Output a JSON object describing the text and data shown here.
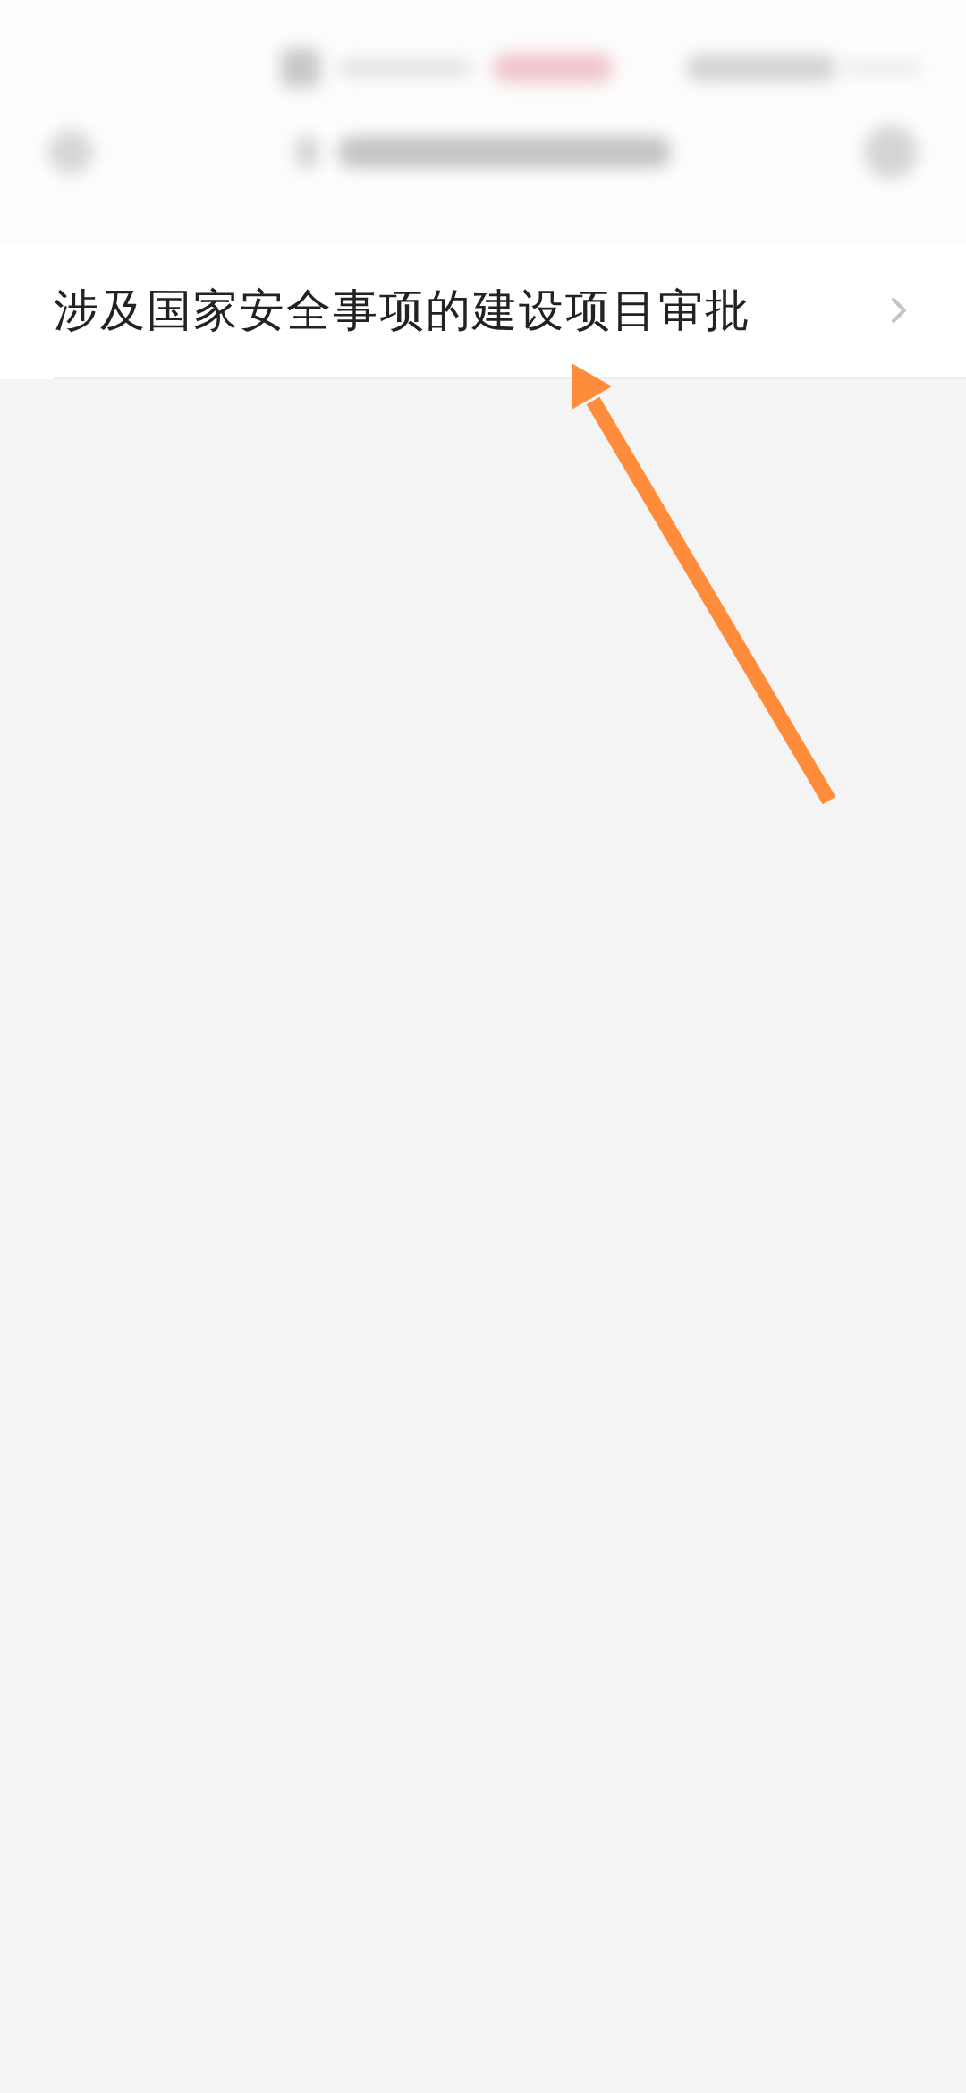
{
  "list_items": [
    {
      "title": "涉及国家安全事项的建设项目审批"
    }
  ],
  "annotation": {
    "kind": "arrow"
  }
}
